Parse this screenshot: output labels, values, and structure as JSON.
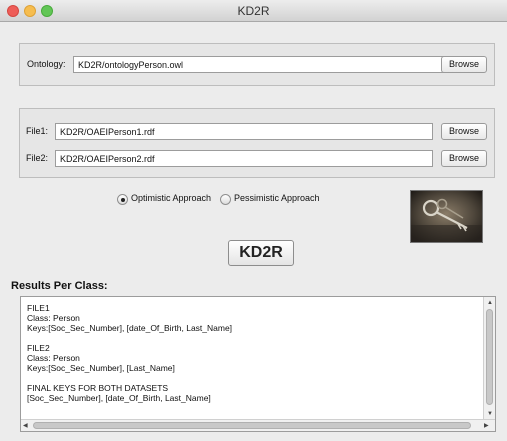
{
  "window": {
    "title": "KD2R"
  },
  "ontology": {
    "label": "Ontology:",
    "value": "KD2R/ontologyPerson.owl",
    "browse_label": "Browse"
  },
  "files": {
    "file1": {
      "label": "File1:",
      "value": "KD2R/OAEIPerson1.rdf",
      "browse_label": "Browse"
    },
    "file2": {
      "label": "File2:",
      "value": "KD2R/OAEIPerson2.rdf",
      "browse_label": "Browse"
    }
  },
  "approach": {
    "options": [
      {
        "label": "Optimistic Approach",
        "selected": true
      },
      {
        "label": "Pessimistic Approach",
        "selected": false
      }
    ]
  },
  "run_button_label": "KD2R",
  "results": {
    "title": "Results Per Class:",
    "lines": [
      "FILE1",
      "Class: Person",
      "Keys:[Soc_Sec_Number], [date_Of_Birth, Last_Name]",
      "",
      "FILE2",
      "Class: Person",
      "Keys:[Soc_Sec_Number], [Last_Name]",
      "",
      "FINAL KEYS FOR BOTH DATASETS",
      "[Soc_Sec_Number], [date_Of_Birth, Last_Name]"
    ]
  },
  "icons": {
    "close": "close-window-icon",
    "minimize": "minimize-window-icon",
    "maximize": "maximize-window-icon",
    "photo": "keys-photo"
  },
  "colors": {
    "window_bg": "#ececec",
    "panel_bg": "#e6e6e6",
    "close": "#ee5d58",
    "minimize": "#f6bd4f",
    "maximize": "#62c656"
  }
}
